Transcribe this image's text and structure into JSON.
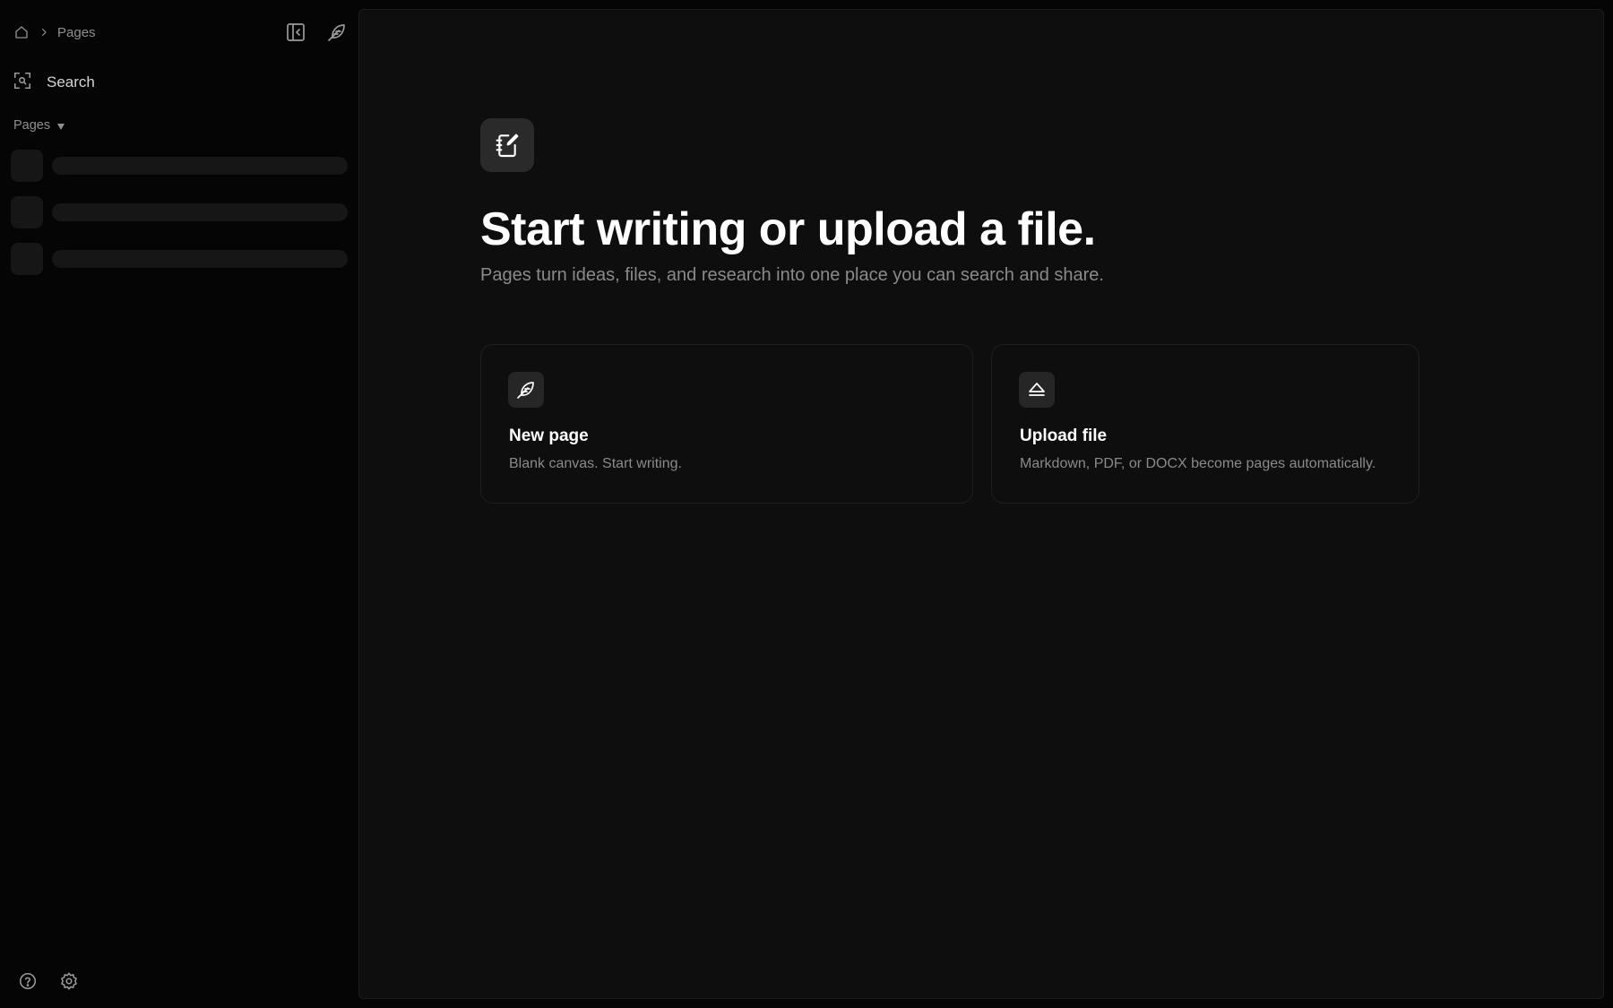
{
  "sidebar": {
    "breadcrumb": {
      "home_icon": "home-icon",
      "separator_icon": "chevron-right-icon",
      "current": "Pages"
    },
    "top_actions": [
      {
        "icon": "collapse-sidebar-icon"
      },
      {
        "icon": "feather-icon"
      }
    ],
    "search": {
      "icon": "search-icon",
      "label": "Search"
    },
    "section": {
      "label": "Pages",
      "caret_icon": "caret-down-icon"
    },
    "loading_rows": 3,
    "bottom_actions": [
      {
        "icon": "help-icon"
      },
      {
        "icon": "settings-icon"
      }
    ]
  },
  "main": {
    "hero_icon": "notebook-edit-icon",
    "headline": "Start writing or upload a file.",
    "subline": "Pages turn ideas, files, and research into one place you can search and share.",
    "cards": [
      {
        "icon": "feather-icon",
        "title": "New page",
        "description": "Blank canvas. Start writing."
      },
      {
        "icon": "eject-upload-icon",
        "title": "Upload file",
        "description": "Markdown, PDF, or DOCX become pages automatically."
      }
    ]
  },
  "colors": {
    "sidebar_bg": "#050505",
    "main_bg": "#0e0e0e",
    "skeleton": "#161616",
    "muted_text": "#8a8a8a"
  }
}
